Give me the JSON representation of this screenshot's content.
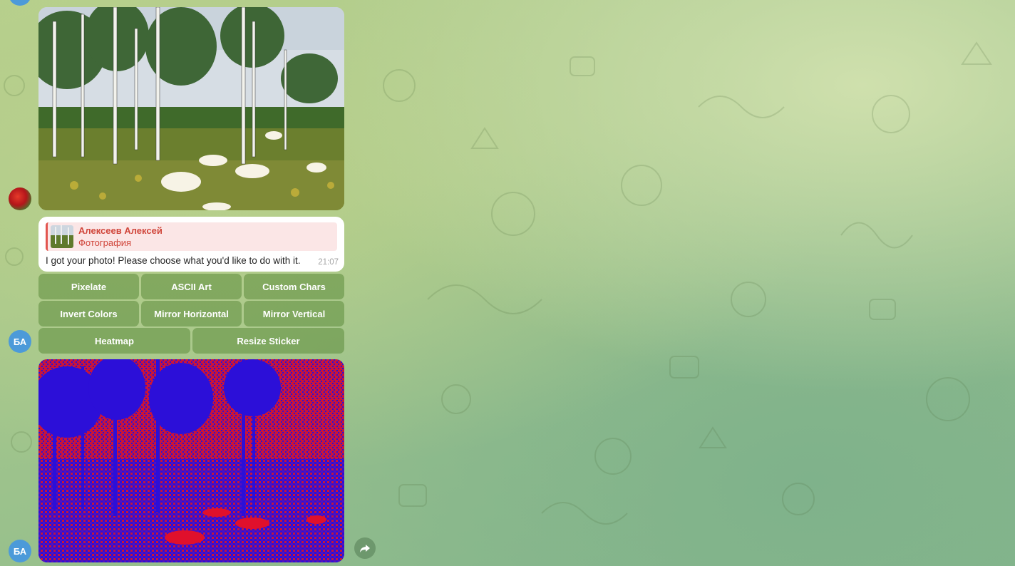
{
  "chat": {
    "reply_message": {
      "quote_author": "Алексеев Алексей",
      "quote_caption": "Фотография",
      "text": "I got your photo! Please choose what you'd like to do with it.",
      "time": "21:07"
    },
    "keyboard": {
      "row1": [
        "Pixelate",
        "ASCII Art",
        "Custom Chars"
      ],
      "row2": [
        "Invert Colors",
        "Mirror Horizontal",
        "Mirror Vertical"
      ],
      "row3": [
        "Heatmap",
        "Resize Sticker"
      ]
    },
    "avatars": {
      "bot_initials": "БА"
    },
    "photos": {
      "original": {
        "subject": "birch trees in a meadow with white flowers"
      },
      "processed": {
        "subject": "heatmap version of the birch meadow photo",
        "colors": [
          "#c8143c",
          "#2c0fd8"
        ]
      }
    }
  }
}
